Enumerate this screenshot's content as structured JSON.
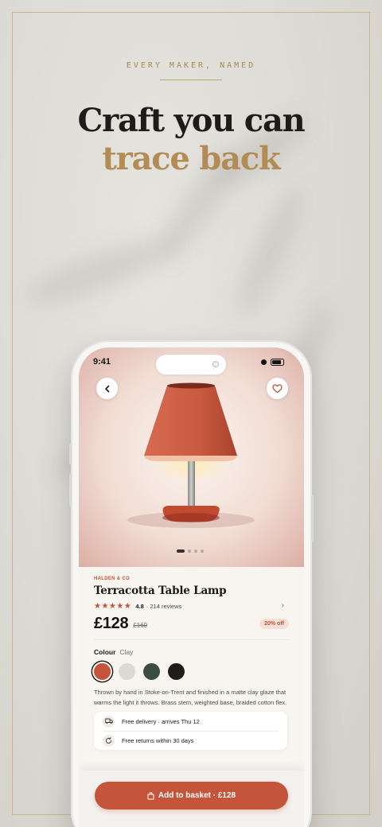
{
  "poster": {
    "eyebrow": "EVERY MAKER, NAMED",
    "headline_line1": "Craft you can",
    "headline_line2": "trace back"
  },
  "status_bar": {
    "time": "9:41"
  },
  "product": {
    "maker": "HALDEN & CO",
    "name": "Terracotta Table Lamp",
    "rating": "4.8",
    "reviews": "· 214 reviews",
    "price": "£128",
    "old_price": "£160",
    "discount": "20% off",
    "colour_label": "Colour",
    "colour_value": "Clay",
    "swatches": [
      {
        "name": "Clay",
        "color": "#c4553a"
      },
      {
        "name": "Stone",
        "color": "#dddad4"
      },
      {
        "name": "Moss",
        "color": "#3c4d3e"
      },
      {
        "name": "Charcoal",
        "color": "#1f1d1a"
      }
    ],
    "description": "Thrown by hand in Stoke-on-Trent and finished in a matte clay glaze that warms the light it throws. Brass stem, weighted base, braided cotton flex.",
    "delivery": "Free delivery · arrives Thu 12",
    "returns": "Free returns within 30 days",
    "stars": "★★★★★",
    "image_count": 4,
    "active_image": 1
  },
  "cta": {
    "label": "Add to basket · £128"
  },
  "icons": {
    "back": "chevron-left-icon",
    "favorite": "heart-icon",
    "rating_more": "chevron-right-icon",
    "delivery": "truck-icon",
    "returns": "refresh-icon",
    "basket": "bag-icon"
  },
  "colors": {
    "accent": "#c4553a",
    "gold": "#b38c55",
    "ink": "#1c1a17"
  }
}
